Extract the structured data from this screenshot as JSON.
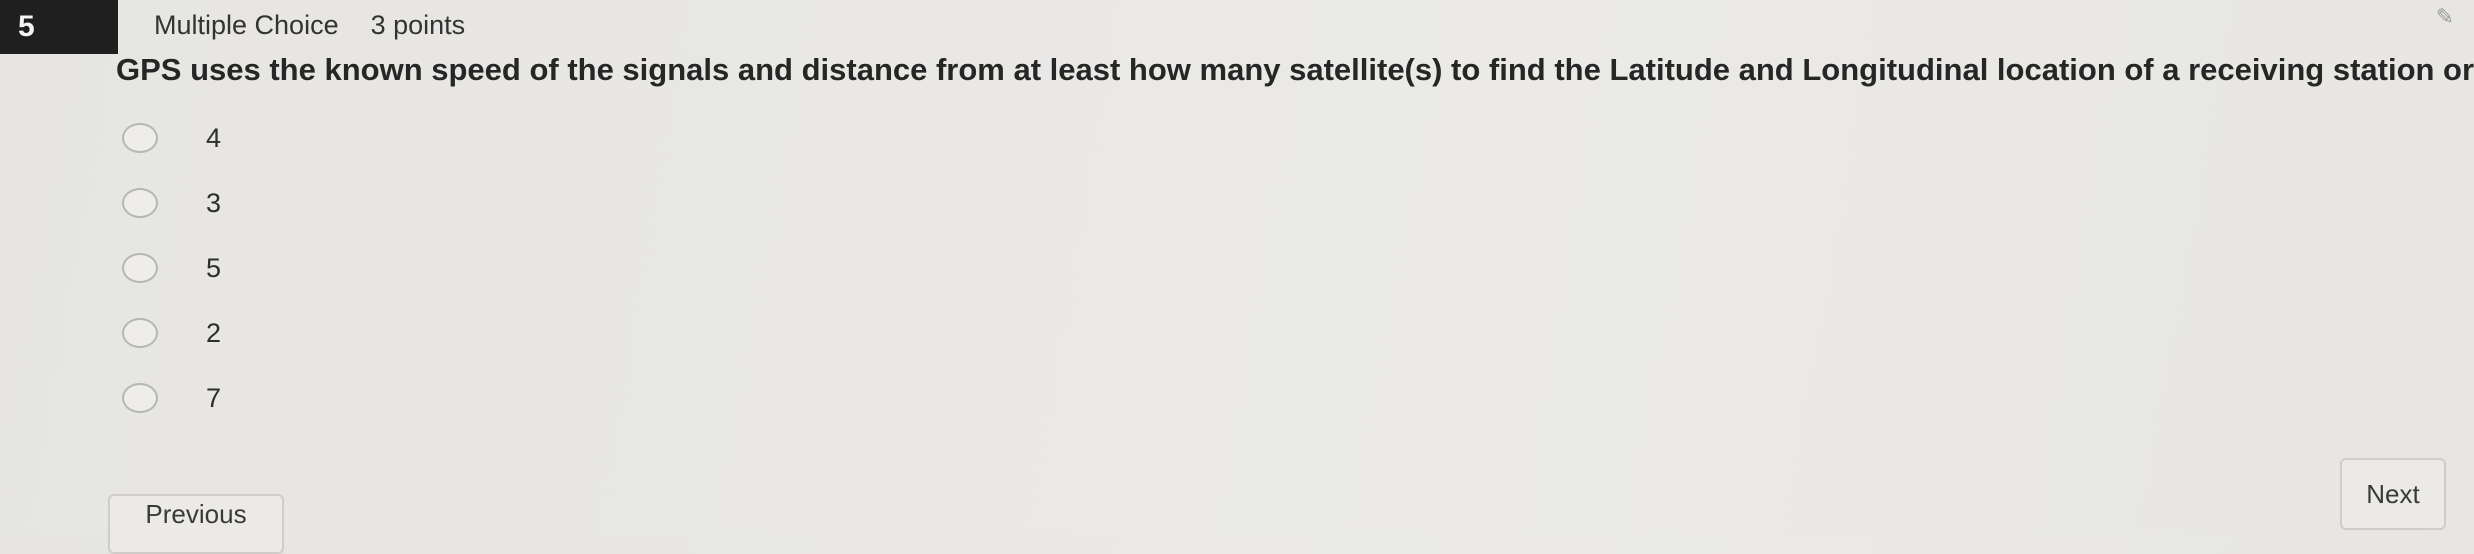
{
  "question": {
    "number": "5",
    "type": "Multiple Choice",
    "points": "3 points",
    "text": "GPS uses the known speed of the signals and distance from at least how many satellite(s) to find the Latitude and Longitudinal location of a receiving station or user?",
    "options": [
      "4",
      "3",
      "5",
      "2",
      "7"
    ]
  },
  "navigation": {
    "next_label": "Next",
    "previous_label": "Previous"
  },
  "icons": {
    "pin": "pin-icon"
  }
}
